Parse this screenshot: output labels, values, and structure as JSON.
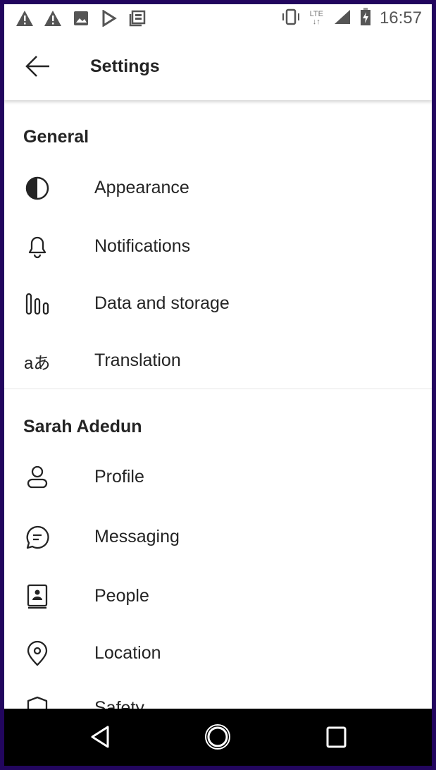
{
  "status_bar": {
    "time": "16:57",
    "network": "LTE",
    "left_icons": [
      "warning-icon",
      "warning-icon",
      "image-icon",
      "play-store-icon",
      "news-icon"
    ],
    "right_icons": [
      "vibrate-icon",
      "lte-icon",
      "signal-icon",
      "battery-charging-icon"
    ]
  },
  "header": {
    "title": "Settings"
  },
  "sections": [
    {
      "title": "General",
      "items": [
        {
          "label": "Appearance",
          "icon": "contrast-icon"
        },
        {
          "label": "Notifications",
          "icon": "bell-icon"
        },
        {
          "label": "Data and storage",
          "icon": "storage-bars-icon"
        },
        {
          "label": "Translation",
          "icon": "translate-icon"
        }
      ]
    },
    {
      "title": "Sarah Adedun",
      "items": [
        {
          "label": "Profile",
          "icon": "person-icon"
        },
        {
          "label": "Messaging",
          "icon": "chat-icon"
        },
        {
          "label": "People",
          "icon": "contacts-book-icon"
        },
        {
          "label": "Location",
          "icon": "location-pin-icon"
        },
        {
          "label": "Safety",
          "icon": "shield-icon"
        }
      ]
    }
  ],
  "colors": {
    "frame": "#22065e",
    "text": "#242424"
  }
}
